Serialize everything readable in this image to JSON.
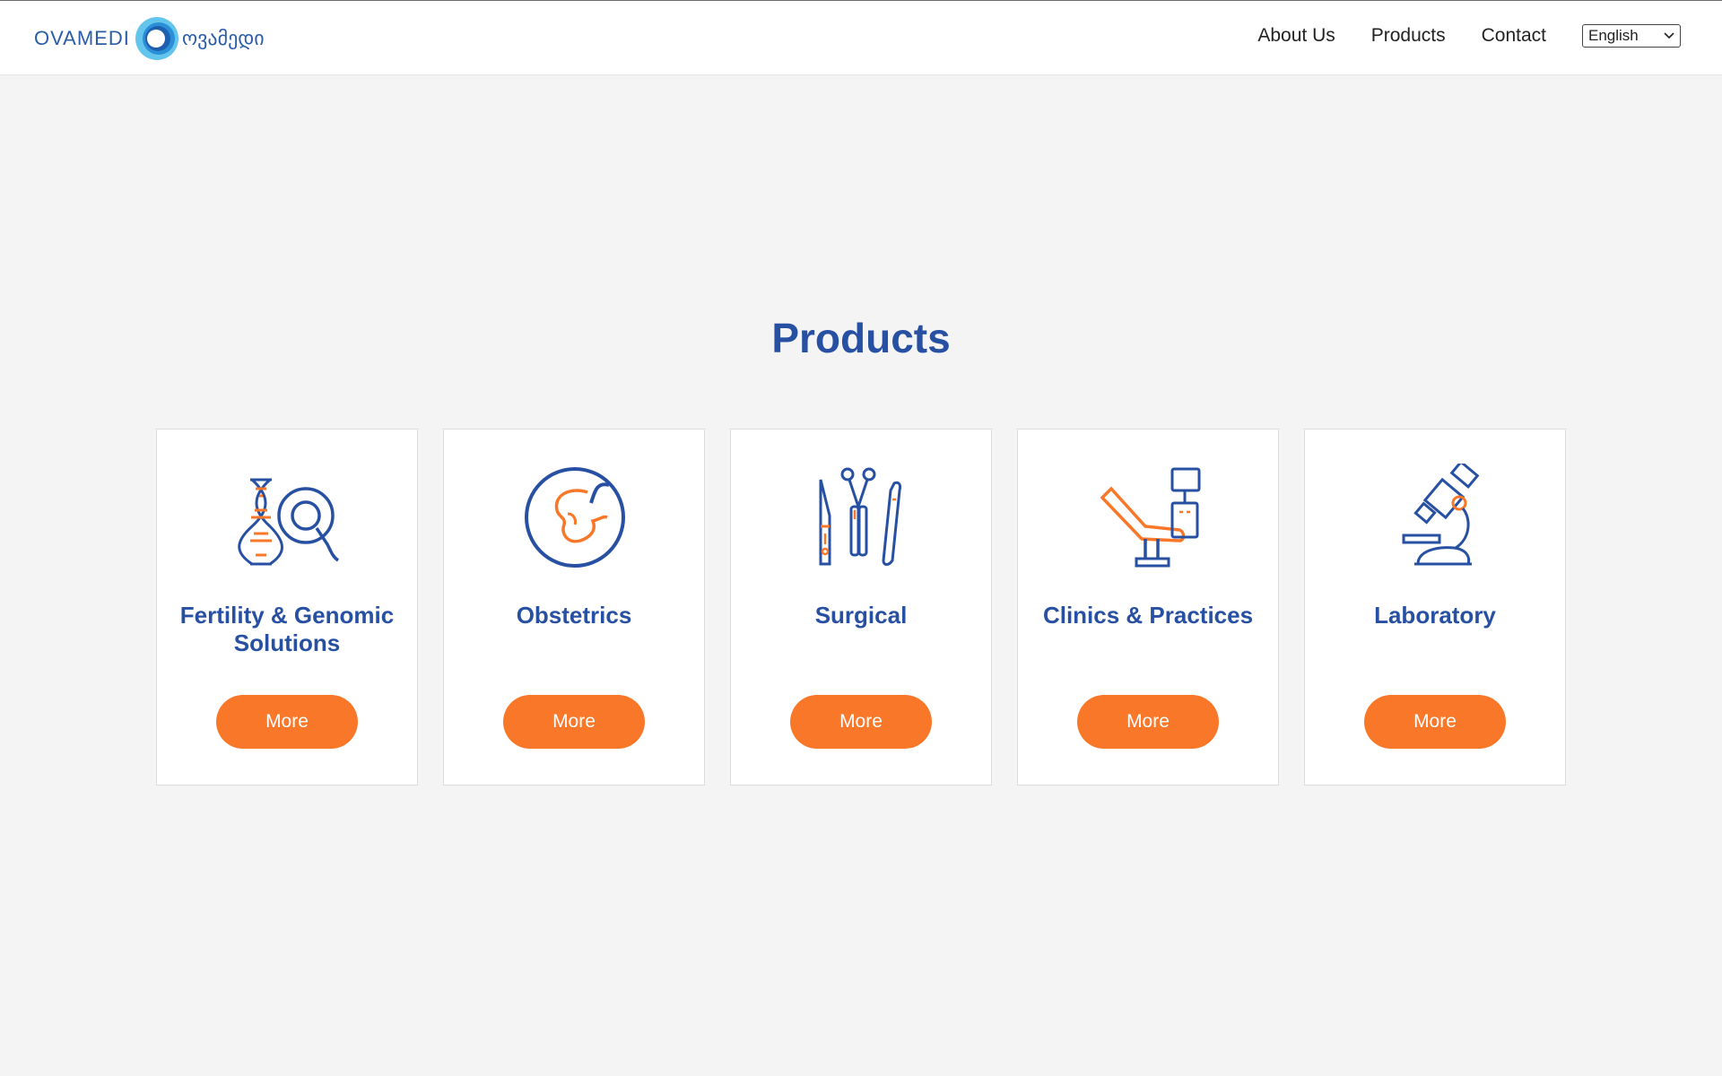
{
  "header": {
    "logo_text": "OVAMEDI",
    "logo_geo": "ოვამედი",
    "nav": [
      "About Us",
      "Products",
      "Contact"
    ],
    "language": "English"
  },
  "main": {
    "title": "Products",
    "cards": [
      {
        "title": "Fertility & Genomic Solutions",
        "icon": "dna-magnifier-icon",
        "button": "More"
      },
      {
        "title": "Obstetrics",
        "icon": "embryo-icon",
        "button": "More"
      },
      {
        "title": "Surgical",
        "icon": "surgical-instruments-icon",
        "button": "More"
      },
      {
        "title": "Clinics & Practices",
        "icon": "examination-chair-icon",
        "button": "More"
      },
      {
        "title": "Laboratory",
        "icon": "microscope-icon",
        "button": "More"
      }
    ]
  },
  "colors": {
    "brand_blue": "#2750a3",
    "accent_orange": "#f97729",
    "background": "#f4f4f4"
  }
}
